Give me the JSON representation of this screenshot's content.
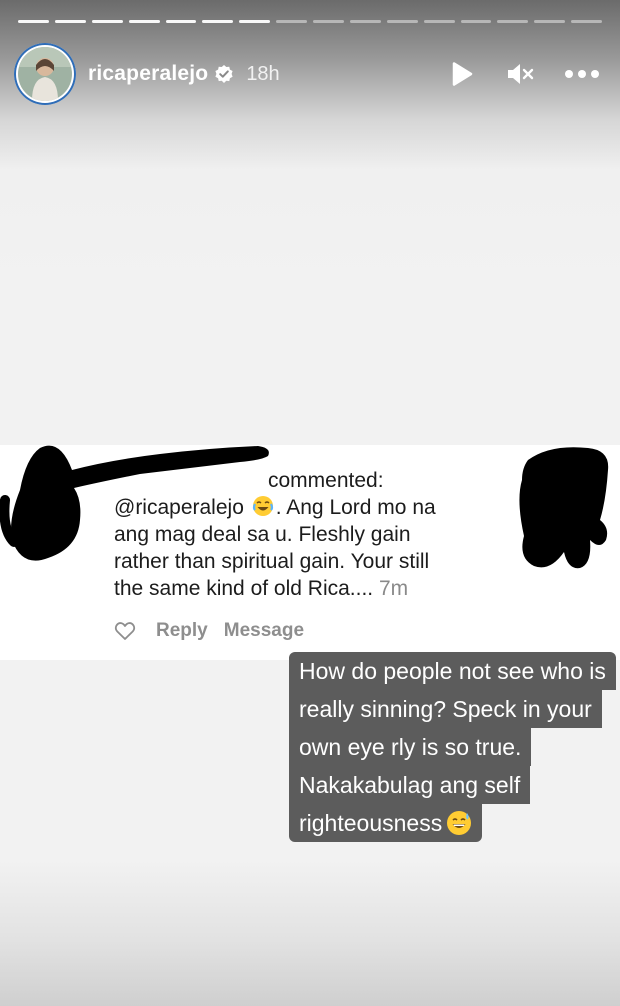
{
  "story": {
    "username": "ricaperalejo",
    "time_ago": "18h",
    "segments_total": 16,
    "segments_done": 7
  },
  "comment": {
    "header_suffix": "commented:",
    "line1_prefix": "@ricaperalejo",
    "line1_suffix": ". Ang Lord mo na",
    "line2": "ang mag deal sa u. Fleshly gain",
    "line3": "rather than spiritual gain. Your still",
    "line4": "the same kind of old Rica....",
    "age": "7m",
    "reply_label": "Reply",
    "message_label": "Message"
  },
  "caption": {
    "line1": "How do people not see who is",
    "line2": "really sinning? Speck in your",
    "line3": "own eye rly is so true.",
    "line4": "Nakakabulag ang self",
    "line5": "righteousness"
  },
  "icons": {
    "verified": "verified-badge-icon",
    "play": "play-icon",
    "mute": "muted-speaker-icon",
    "more": "more-options-icon",
    "like": "heart-icon",
    "emoji1": "laughing-crying-emoji",
    "emoji2": "sweat-smile-emoji"
  },
  "colors": {
    "caption_bg": "#5c5c5c",
    "avatar_ring": "#2f6db7",
    "secondary_text": "#8e8e8e"
  }
}
